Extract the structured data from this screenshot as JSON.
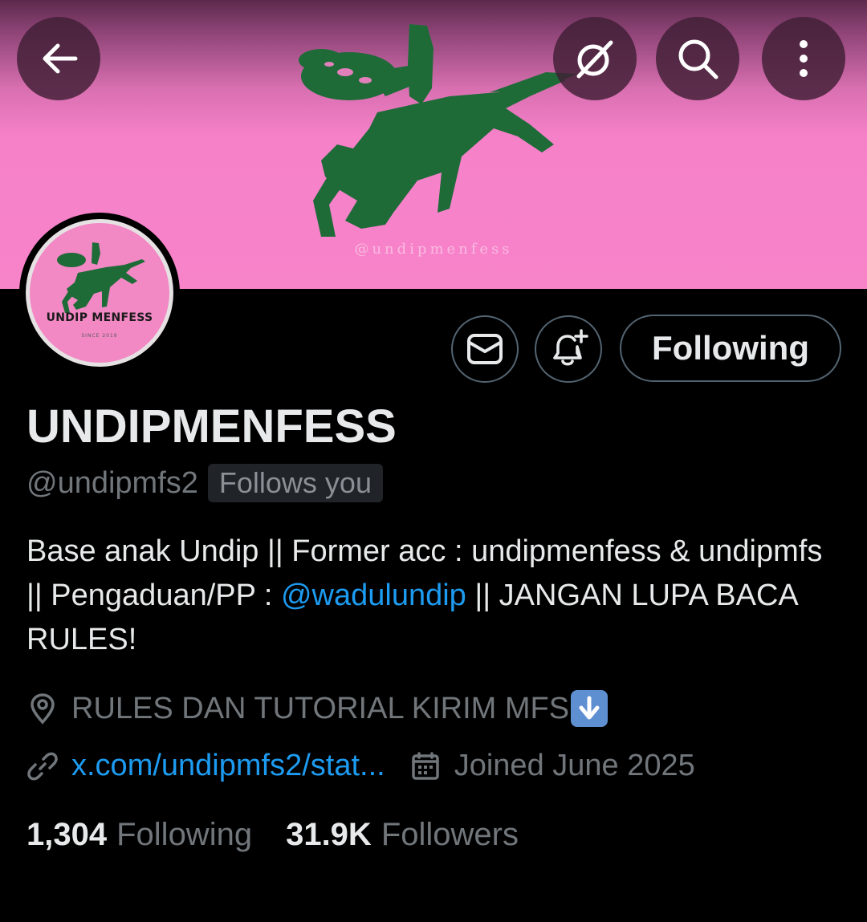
{
  "colors": {
    "background": "#000000",
    "banner_pink": "#f783c9",
    "horse_green": "#1e6b38",
    "text_primary": "#e7e9ea",
    "text_secondary": "#71767b",
    "link_blue": "#1d9bf0",
    "button_border": "#536471"
  },
  "banner": {
    "watermark": "@undipmenfess"
  },
  "nav": {
    "back_icon": "arrow-left-icon",
    "grok_icon": "grok-icon",
    "search_icon": "search-icon",
    "more_icon": "more-vertical-icon"
  },
  "avatar": {
    "title": "UNDIP MENFESS",
    "subtitle": "SINCE 2019"
  },
  "actions": {
    "message_icon": "envelope-icon",
    "notify_icon": "bell-plus-icon",
    "following_label": "Following"
  },
  "profile": {
    "display_name": "UNDIPMENFESS",
    "handle": "@undipmfs2",
    "follows_you": "Follows you",
    "bio": {
      "part1": "Base anak Undip || Former acc : undipmenfess & undipmfs || Pengaduan/PP : ",
      "mention": "@wadulundip",
      "part2": " || JANGAN LUPA BACA RULES!"
    },
    "location": "RULES DAN TUTORIAL KIRIM MFS",
    "link": "x.com/undipmfs2/stat...",
    "joined": "Joined June 2025"
  },
  "stats": {
    "following_count": "1,304",
    "following_label": "Following",
    "followers_count": "31.9K",
    "followers_label": "Followers"
  }
}
